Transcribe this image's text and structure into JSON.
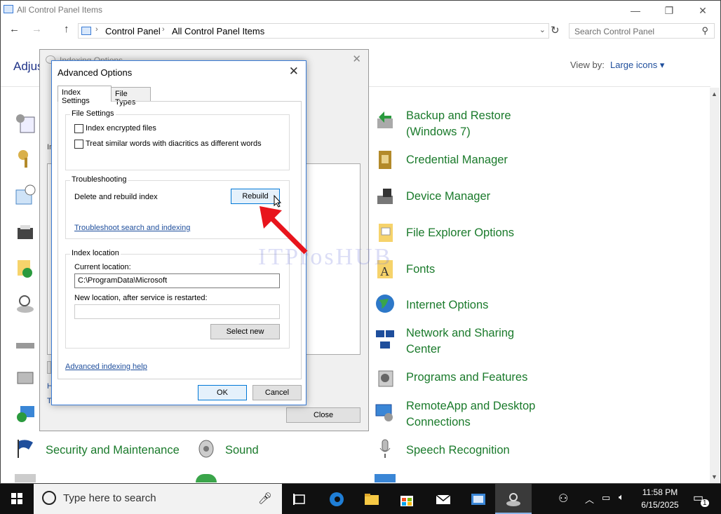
{
  "window": {
    "title": "All Control Panel Items",
    "minimize": "—",
    "restore": "❐",
    "close": "✕"
  },
  "nav": {
    "back": "←",
    "forward": "→",
    "up": "↑"
  },
  "address": {
    "crumbs": [
      "Control Panel",
      "All Control Panel Items"
    ],
    "separator": "›",
    "dropdown": "⌄",
    "refresh": "↻"
  },
  "search": {
    "placeholder": "Search Control Panel",
    "icon": "⚲"
  },
  "page": {
    "heading": "Adjus",
    "view_by_label": "View by:",
    "view_by_value": "Large icons ▾"
  },
  "items_right": [
    "Backup and Restore\n(Windows 7)",
    "Credential Manager",
    "Device Manager",
    "File Explorer Options",
    "Fonts",
    "Internet Options",
    "Network and Sharing\nCenter",
    "Programs and Features",
    "RemoteApp and Desktop\nConnections",
    "Speech Recognition"
  ],
  "items_bottom": [
    "Security and Maintenance",
    "Sound"
  ],
  "indexing_dialog": {
    "title": "Indexing Options",
    "close_glyph": "✕",
    "label_fragment": "In",
    "link1_fragment": "H",
    "link2_fragment": "T",
    "close_button": "Close"
  },
  "advanced_dialog": {
    "title": "Advanced Options",
    "close_glyph": "✕",
    "tabs": [
      "Index Settings",
      "File Types"
    ],
    "file_settings": {
      "legend": "File Settings",
      "options": [
        "Index encrypted files",
        "Treat similar words with diacritics as different words"
      ]
    },
    "troubleshooting": {
      "legend": "Troubleshooting",
      "delete_rebuild_label": "Delete and rebuild index",
      "rebuild_button": "Rebuild",
      "troubleshoot_link": "Troubleshoot search and indexing"
    },
    "index_location": {
      "legend": "Index location",
      "current_label": "Current location:",
      "current_value": "C:\\ProgramData\\Microsoft",
      "new_label": "New location, after service is restarted:",
      "new_value": "",
      "select_new_button": "Select new"
    },
    "help_link": "Advanced indexing help",
    "ok_button": "OK",
    "cancel_button": "Cancel"
  },
  "watermark": "ITProsHUB",
  "taskbar": {
    "search_placeholder": "Type here to search",
    "time": "11:58 PM",
    "date": "6/15/2025",
    "notification_count": "1"
  },
  "colors": {
    "link_green": "#1a7a2b",
    "accent": "#0078d7",
    "arrow": "#e8141c"
  }
}
